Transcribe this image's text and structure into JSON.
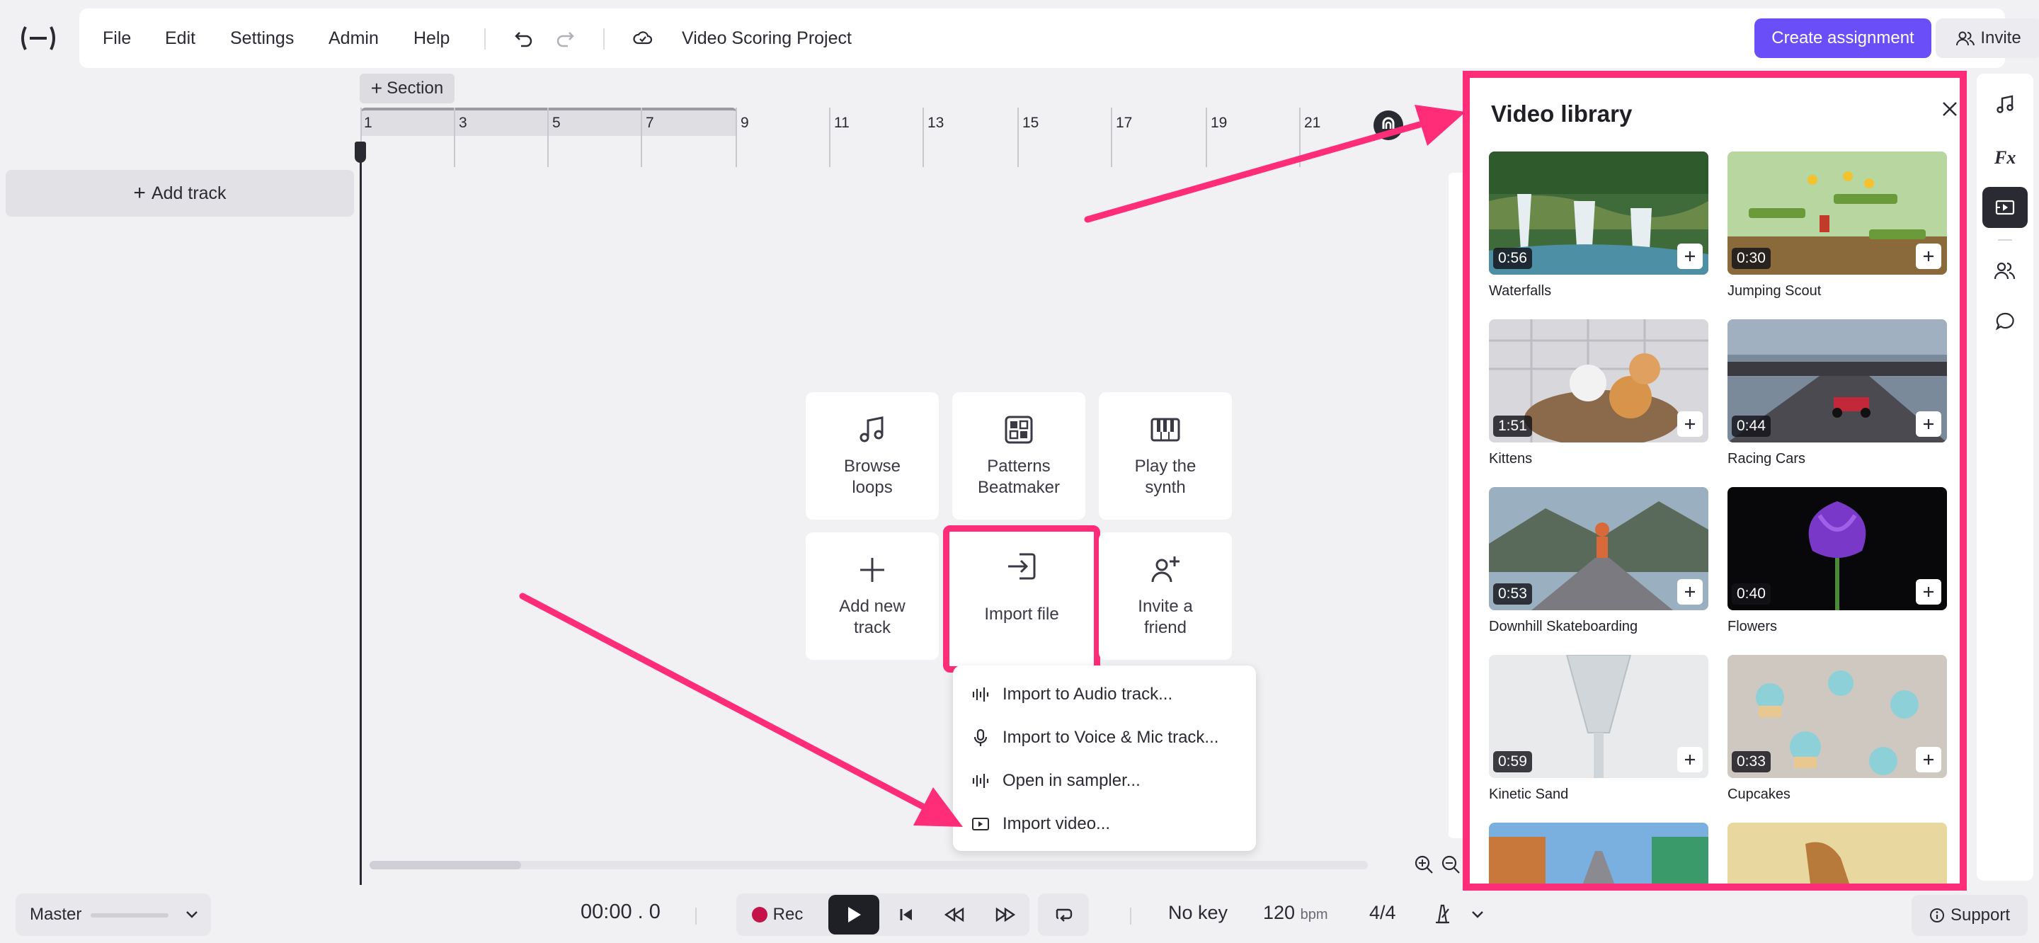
{
  "app": {
    "logo": "(—)",
    "project_title": "Video Scoring Project",
    "menu": [
      "File",
      "Edit",
      "Settings",
      "Admin",
      "Help"
    ],
    "create_assignment": "Create assignment",
    "invite": "Invite"
  },
  "timeline": {
    "section_button": "Section",
    "add_track": "Add track",
    "ruler_numbers": [
      "1",
      "3",
      "5",
      "7",
      "9",
      "11",
      "13",
      "15",
      "17",
      "19",
      "21"
    ]
  },
  "quick_actions": [
    {
      "label": "Browse\nloops",
      "icon": "music-note-icon"
    },
    {
      "label": "Patterns\nBeatmaker",
      "icon": "grid-icon"
    },
    {
      "label": "Play the\nsynth",
      "icon": "piano-icon"
    },
    {
      "label": "Add new\ntrack",
      "icon": "plus-icon"
    },
    {
      "label": "Import file",
      "icon": "import-icon"
    },
    {
      "label": "Invite a\nfriend",
      "icon": "add-person-icon"
    }
  ],
  "import_menu": [
    {
      "label": "Import to Audio track...",
      "icon": "waveform-icon"
    },
    {
      "label": "Import to Voice & Mic track...",
      "icon": "microphone-icon"
    },
    {
      "label": "Open in sampler...",
      "icon": "waveform-icon"
    },
    {
      "label": "Import video...",
      "icon": "video-icon"
    }
  ],
  "video_library": {
    "title": "Video library",
    "videos": [
      {
        "name": "Waterfalls",
        "duration": "0:56"
      },
      {
        "name": "Jumping Scout",
        "duration": "0:30"
      },
      {
        "name": "Kittens",
        "duration": "1:51"
      },
      {
        "name": "Racing Cars",
        "duration": "0:44"
      },
      {
        "name": "Downhill Skateboarding",
        "duration": "0:53"
      },
      {
        "name": "Flowers",
        "duration": "0:40"
      },
      {
        "name": "Kinetic Sand",
        "duration": "0:59"
      },
      {
        "name": "Cupcakes",
        "duration": "0:33"
      },
      {
        "name": "",
        "duration": ""
      },
      {
        "name": "",
        "duration": ""
      }
    ]
  },
  "bottom_bar": {
    "master": "Master",
    "time": "00:00 . 0",
    "rec": "Rec",
    "key": "No key",
    "bpm_value": "120",
    "bpm_unit": "bpm",
    "time_signature": "4/4",
    "support": "Support"
  },
  "colors": {
    "accent": "#6a4ff8",
    "highlight": "#ff2d78",
    "rec": "#c3134a"
  }
}
